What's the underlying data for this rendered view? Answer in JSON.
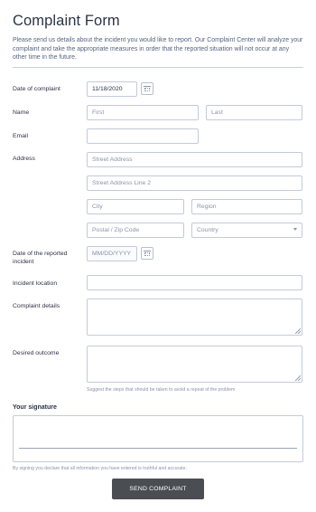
{
  "form": {
    "title": "Complaint Form",
    "intro": "Please send us details about the incident you would like to report. Our Complaint Center will analyze your complaint and take the appropriate measures in order that the reported situation will not occur at any other time in the future."
  },
  "fields": {
    "date_of_complaint": {
      "label": "Date of complaint",
      "value": "11/18/2020"
    },
    "name": {
      "label": "Name",
      "first_placeholder": "First",
      "last_placeholder": "Last"
    },
    "email": {
      "label": "Email",
      "value": ""
    },
    "address": {
      "label": "Address",
      "street_placeholder": "Street Address",
      "street2_placeholder": "Street Address Line 2",
      "city_placeholder": "City",
      "region_placeholder": "Region",
      "postal_placeholder": "Postal / Zip Code",
      "country_placeholder": "Country"
    },
    "date_reported": {
      "label": "Date of the reported incident",
      "placeholder": "MM/DD/YYYY"
    },
    "incident_location": {
      "label": "Incident location",
      "value": ""
    },
    "complaint_details": {
      "label": "Complaint details",
      "value": ""
    },
    "desired_outcome": {
      "label": "Desired outcome",
      "value": "",
      "sublabel": "Suggest the steps that should be taken to avoid a repeat of the problem"
    }
  },
  "signature": {
    "label": "Your signature",
    "disclaimer": "By signing you declare that all information you have entered is truthful and accurate."
  },
  "submit_label": "SEND COMPLAINT",
  "icons": {
    "calendar": "calendar-icon",
    "dropdown": "chevron-down-icon"
  },
  "colors": {
    "button_bg": "#4a4d52",
    "border": "#c3cad8",
    "text": "#2c3345"
  }
}
